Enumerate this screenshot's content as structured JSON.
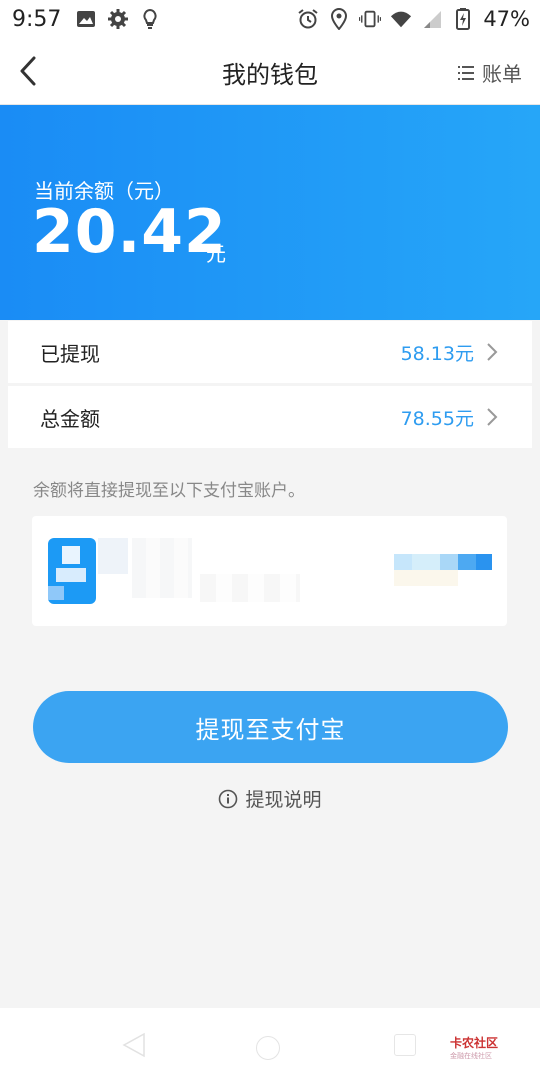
{
  "status_bar": {
    "time": "9:57",
    "battery_percent": "47%",
    "left_icons": [
      "image-icon",
      "gear-icon",
      "bulb-icon"
    ],
    "right_icons": [
      "alarm-icon",
      "location-icon",
      "vibrate-icon",
      "wifi-icon",
      "signal-icon",
      "battery-icon"
    ]
  },
  "header": {
    "title": "我的钱包",
    "bill_label": "账单"
  },
  "balance": {
    "label": "当前余额（元）",
    "value": "20.42",
    "unit": "元"
  },
  "stats": [
    {
      "label": "已提现",
      "value": "58.13元"
    },
    {
      "label": "总金额",
      "value": "78.55元"
    }
  ],
  "account": {
    "hint": "余额将直接提现至以下支付宝账户。"
  },
  "actions": {
    "withdraw_label": "提现至支付宝",
    "explain_label": "提现说明"
  },
  "watermark": {
    "main": "卡农社区",
    "sub": "金融在线社区"
  },
  "colors": {
    "accent": "#1a8cf5",
    "button": "#3ba4f2",
    "value_text": "#2e9cf0"
  }
}
